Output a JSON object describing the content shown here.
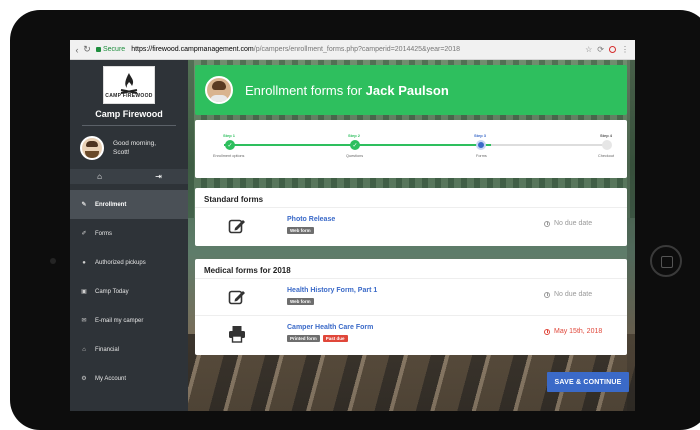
{
  "browser": {
    "secure_label": "Secure",
    "url_host": "https://firewood.campmanagement.com",
    "url_path": "/p/campers/enrollment_forms.php?camperid=2014425&year=2018"
  },
  "sidebar": {
    "logo_text": "CAMP FIREWOOD",
    "camp_name": "Camp Firewood",
    "greeting_line1": "Good morning,",
    "greeting_line2": "Scott!",
    "menu": [
      {
        "label": "Enrollment",
        "icon": "pencil-icon",
        "active": true
      },
      {
        "label": "Forms",
        "icon": "edit-icon",
        "active": false
      },
      {
        "label": "Authorized pickups",
        "icon": "users-icon",
        "active": false
      },
      {
        "label": "Camp Today",
        "icon": "picture-icon",
        "active": false
      },
      {
        "label": "E-mail my camper",
        "icon": "envelope-icon",
        "active": false
      },
      {
        "label": "Financial",
        "icon": "bank-icon",
        "active": false
      },
      {
        "label": "My Account",
        "icon": "gear-icon",
        "active": false
      }
    ]
  },
  "header": {
    "title_prefix": "Enrollment forms for",
    "camper_name": "Jack Paulson"
  },
  "steps": [
    {
      "label": "Step 1",
      "caption": "Enrollment options",
      "state": "done"
    },
    {
      "label": "Step 2",
      "caption": "Questions",
      "state": "done"
    },
    {
      "label": "Step 3",
      "caption": "Forms",
      "state": "current"
    },
    {
      "label": "Step 4",
      "caption": "Checkout",
      "state": "todo"
    }
  ],
  "standard_forms": {
    "title": "Standard forms",
    "items": [
      {
        "name": "Photo Release",
        "badges": [
          "Web form"
        ],
        "due": "No due date",
        "past_due": false,
        "icon": "edit-form-icon"
      }
    ]
  },
  "medical_forms": {
    "title": "Medical forms for 2018",
    "items": [
      {
        "name": "Health History Form, Part 1",
        "badges": [
          "Web form"
        ],
        "due": "No due date",
        "past_due": false,
        "icon": "edit-form-icon"
      },
      {
        "name": "Camper Health Care Form",
        "badges": [
          "Printed form",
          "Past due"
        ],
        "due": "May 15th, 2018",
        "past_due": true,
        "icon": "printer-icon"
      }
    ]
  },
  "actions": {
    "save_continue": "SAVE & CONTINUE"
  },
  "colors": {
    "accent_green": "#2ebf5e",
    "accent_blue": "#3b6ac8",
    "past_due_red": "#e0473a",
    "sidebar_bg": "#2e3338"
  }
}
